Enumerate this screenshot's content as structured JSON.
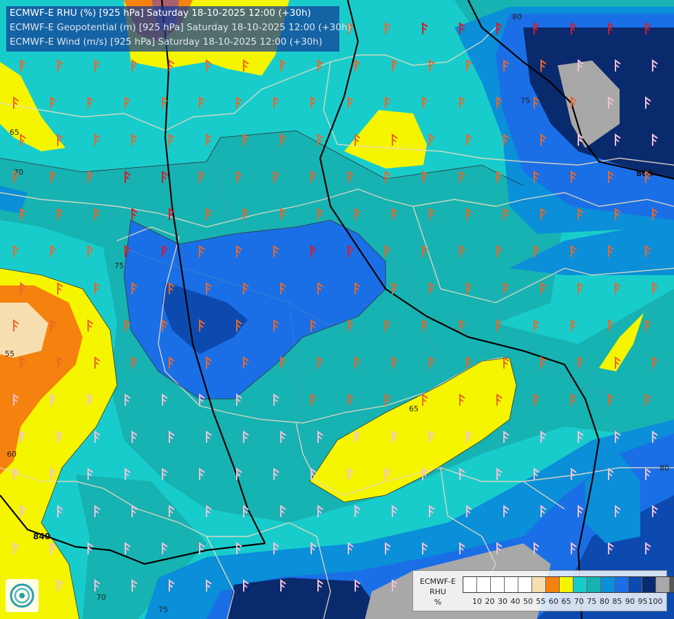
{
  "title": {
    "line1": "ECMWF-E RHU (%) [925 hPa] Saturday 18-10-2025 12:00 (+30h)",
    "line2": "ECMWF-E Geopotential (m) [925 hPa] Saturday 18-10-2025 12:00 (+30h)",
    "line3": "ECMWF-E Wind (m/s) [925 hPa] Saturday 18-10-2025 12:00 (+30h)"
  },
  "legend": {
    "title_line1": "ECMWF-E",
    "title_line2": "RHU",
    "title_line3": "%",
    "ticks": [
      "10",
      "20",
      "30",
      "40",
      "50",
      "55",
      "60",
      "65",
      "70",
      "75",
      "80",
      "85",
      "90",
      "95",
      "100"
    ],
    "colors": [
      "#ffffff",
      "#ffffff",
      "#ffffff",
      "#ffffff",
      "#ffffff",
      "#f7deb0",
      "#f5820e",
      "#f5f500",
      "#19cccc",
      "#17b2b2",
      "#0a8fd8",
      "#1a6fe6",
      "#0d4ab0",
      "#0a2a6e",
      "#a8a8a8",
      "#585858"
    ]
  },
  "contour_labels": {
    "rh_65_a": "65",
    "rh_65_b": "65",
    "rh_70_a": "70",
    "rh_70_b": "70",
    "rh_75_a": "75",
    "rh_75_b": "75",
    "rh_75_c": "75",
    "rh_60": "60",
    "rh_55": "55",
    "rh_80_a": "80",
    "rh_80_b": "80",
    "gp_800": "800",
    "gp_840": "840"
  },
  "icons": {
    "logo": "ecmwf-swirl-logo"
  }
}
